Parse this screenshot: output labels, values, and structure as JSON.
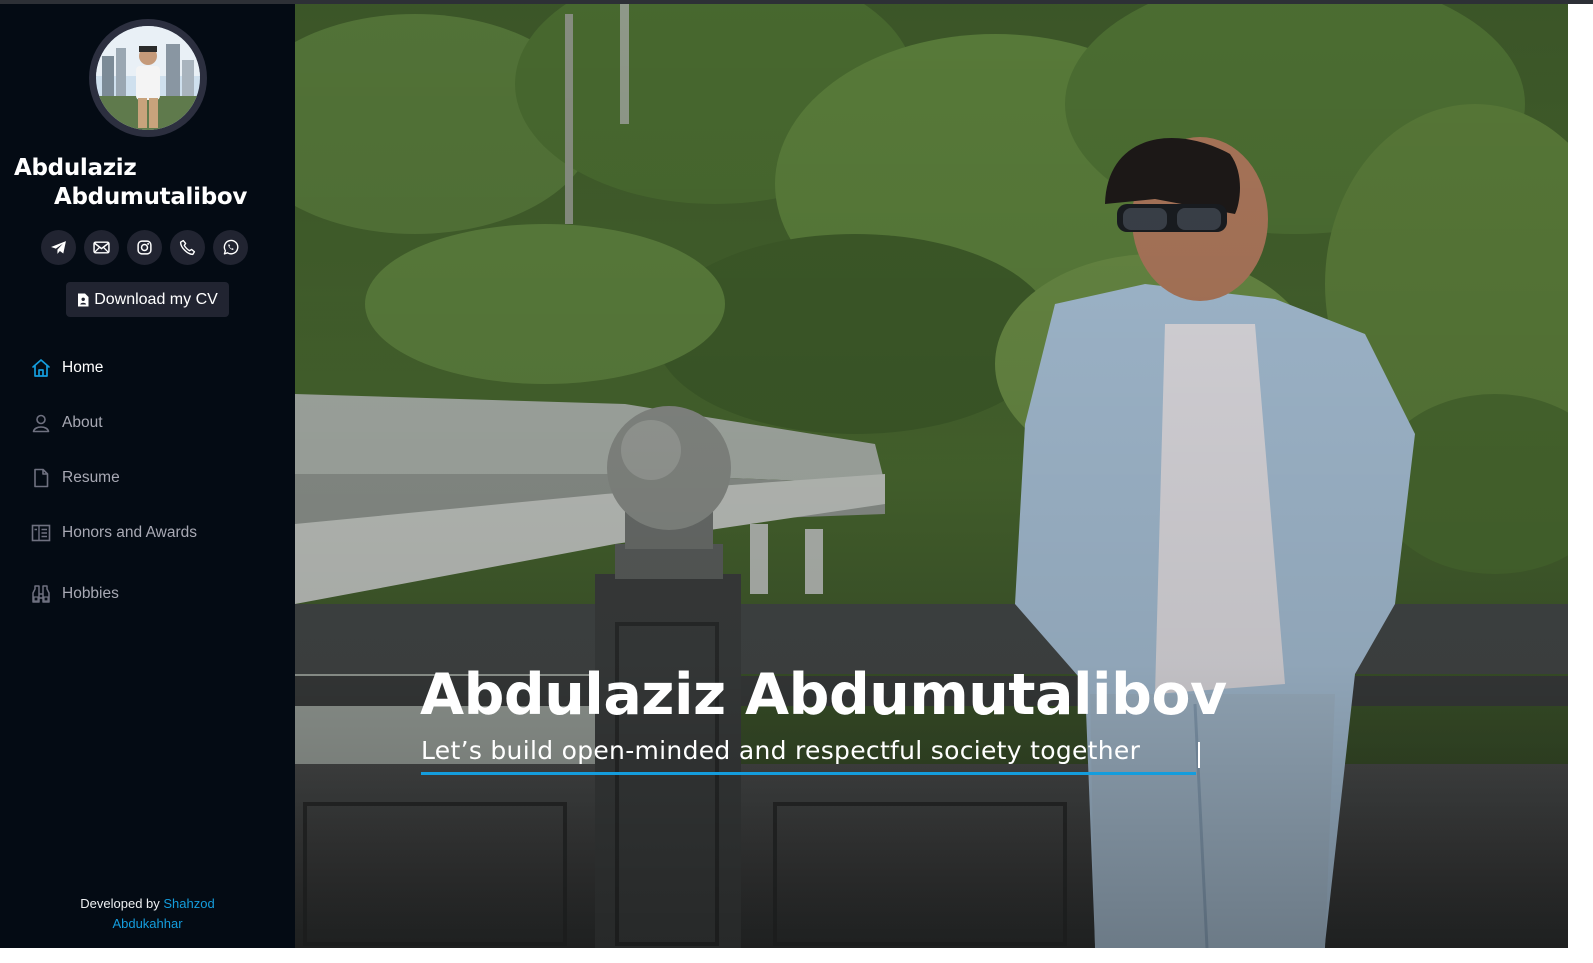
{
  "profile": {
    "name_line1": "Abdulaziz",
    "name_line2": "Abdumutalibov"
  },
  "social": [
    {
      "icon": "telegram-icon"
    },
    {
      "icon": "envelope-icon"
    },
    {
      "icon": "instagram-icon"
    },
    {
      "icon": "phone-icon"
    },
    {
      "icon": "whatsapp-icon"
    }
  ],
  "cv_button": {
    "label": "Download my CV",
    "icon": "file-person-icon"
  },
  "nav": {
    "items": [
      {
        "label": "Home",
        "icon": "house-icon",
        "active": true
      },
      {
        "label": "About",
        "icon": "person-icon",
        "active": false
      },
      {
        "label": "Resume",
        "icon": "file-icon",
        "active": false
      },
      {
        "label": "Honors and Awards",
        "icon": "layout-icon",
        "active": false
      },
      {
        "label": "Hobbies",
        "icon": "binoculars-icon",
        "active": false
      }
    ]
  },
  "footer": {
    "prefix": "Developed by ",
    "link_line1": "Shahzod",
    "link_line2": "Abdukahhar"
  },
  "hero": {
    "title": "Abdulaziz Abdumutalibov",
    "subtitle": "Let’s build open-minded and respectful society together"
  },
  "colors": {
    "sidebar_bg": "#040b14",
    "accent": "#149ddd",
    "icon_bg": "#212431"
  }
}
